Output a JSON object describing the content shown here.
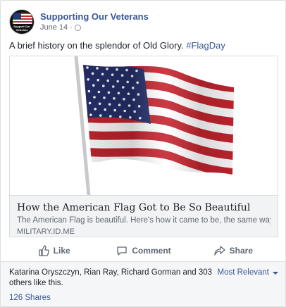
{
  "post": {
    "page_name": "Supporting Our Veterans",
    "avatar_text": "Support Our Veterans",
    "date": "June 14",
    "separator": "·",
    "privacy_icon": "globe-icon",
    "text": "A brief history on the splendor of Old Glory. ",
    "hashtag": "#FlagDay"
  },
  "link": {
    "image_icon": "american-flag-image",
    "title": "How the American Flag Got to Be So Beautiful",
    "description": "The American Flag is beautiful. Here's how it came to be, the same way we…",
    "domain": "MILITARY.ID.ME"
  },
  "actions": {
    "like_label": "Like",
    "comment_label": "Comment",
    "share_label": "Share"
  },
  "footer": {
    "reactors_text": "Katarina Oryszczyn, Rian Ray, Richard Gorman and 303 others like this.",
    "sort_label": "Most Relevant",
    "shares_label": "126 Shares"
  },
  "colors": {
    "link": "#385898",
    "flag_red": "#c4252f",
    "flag_blue": "#25306b"
  }
}
